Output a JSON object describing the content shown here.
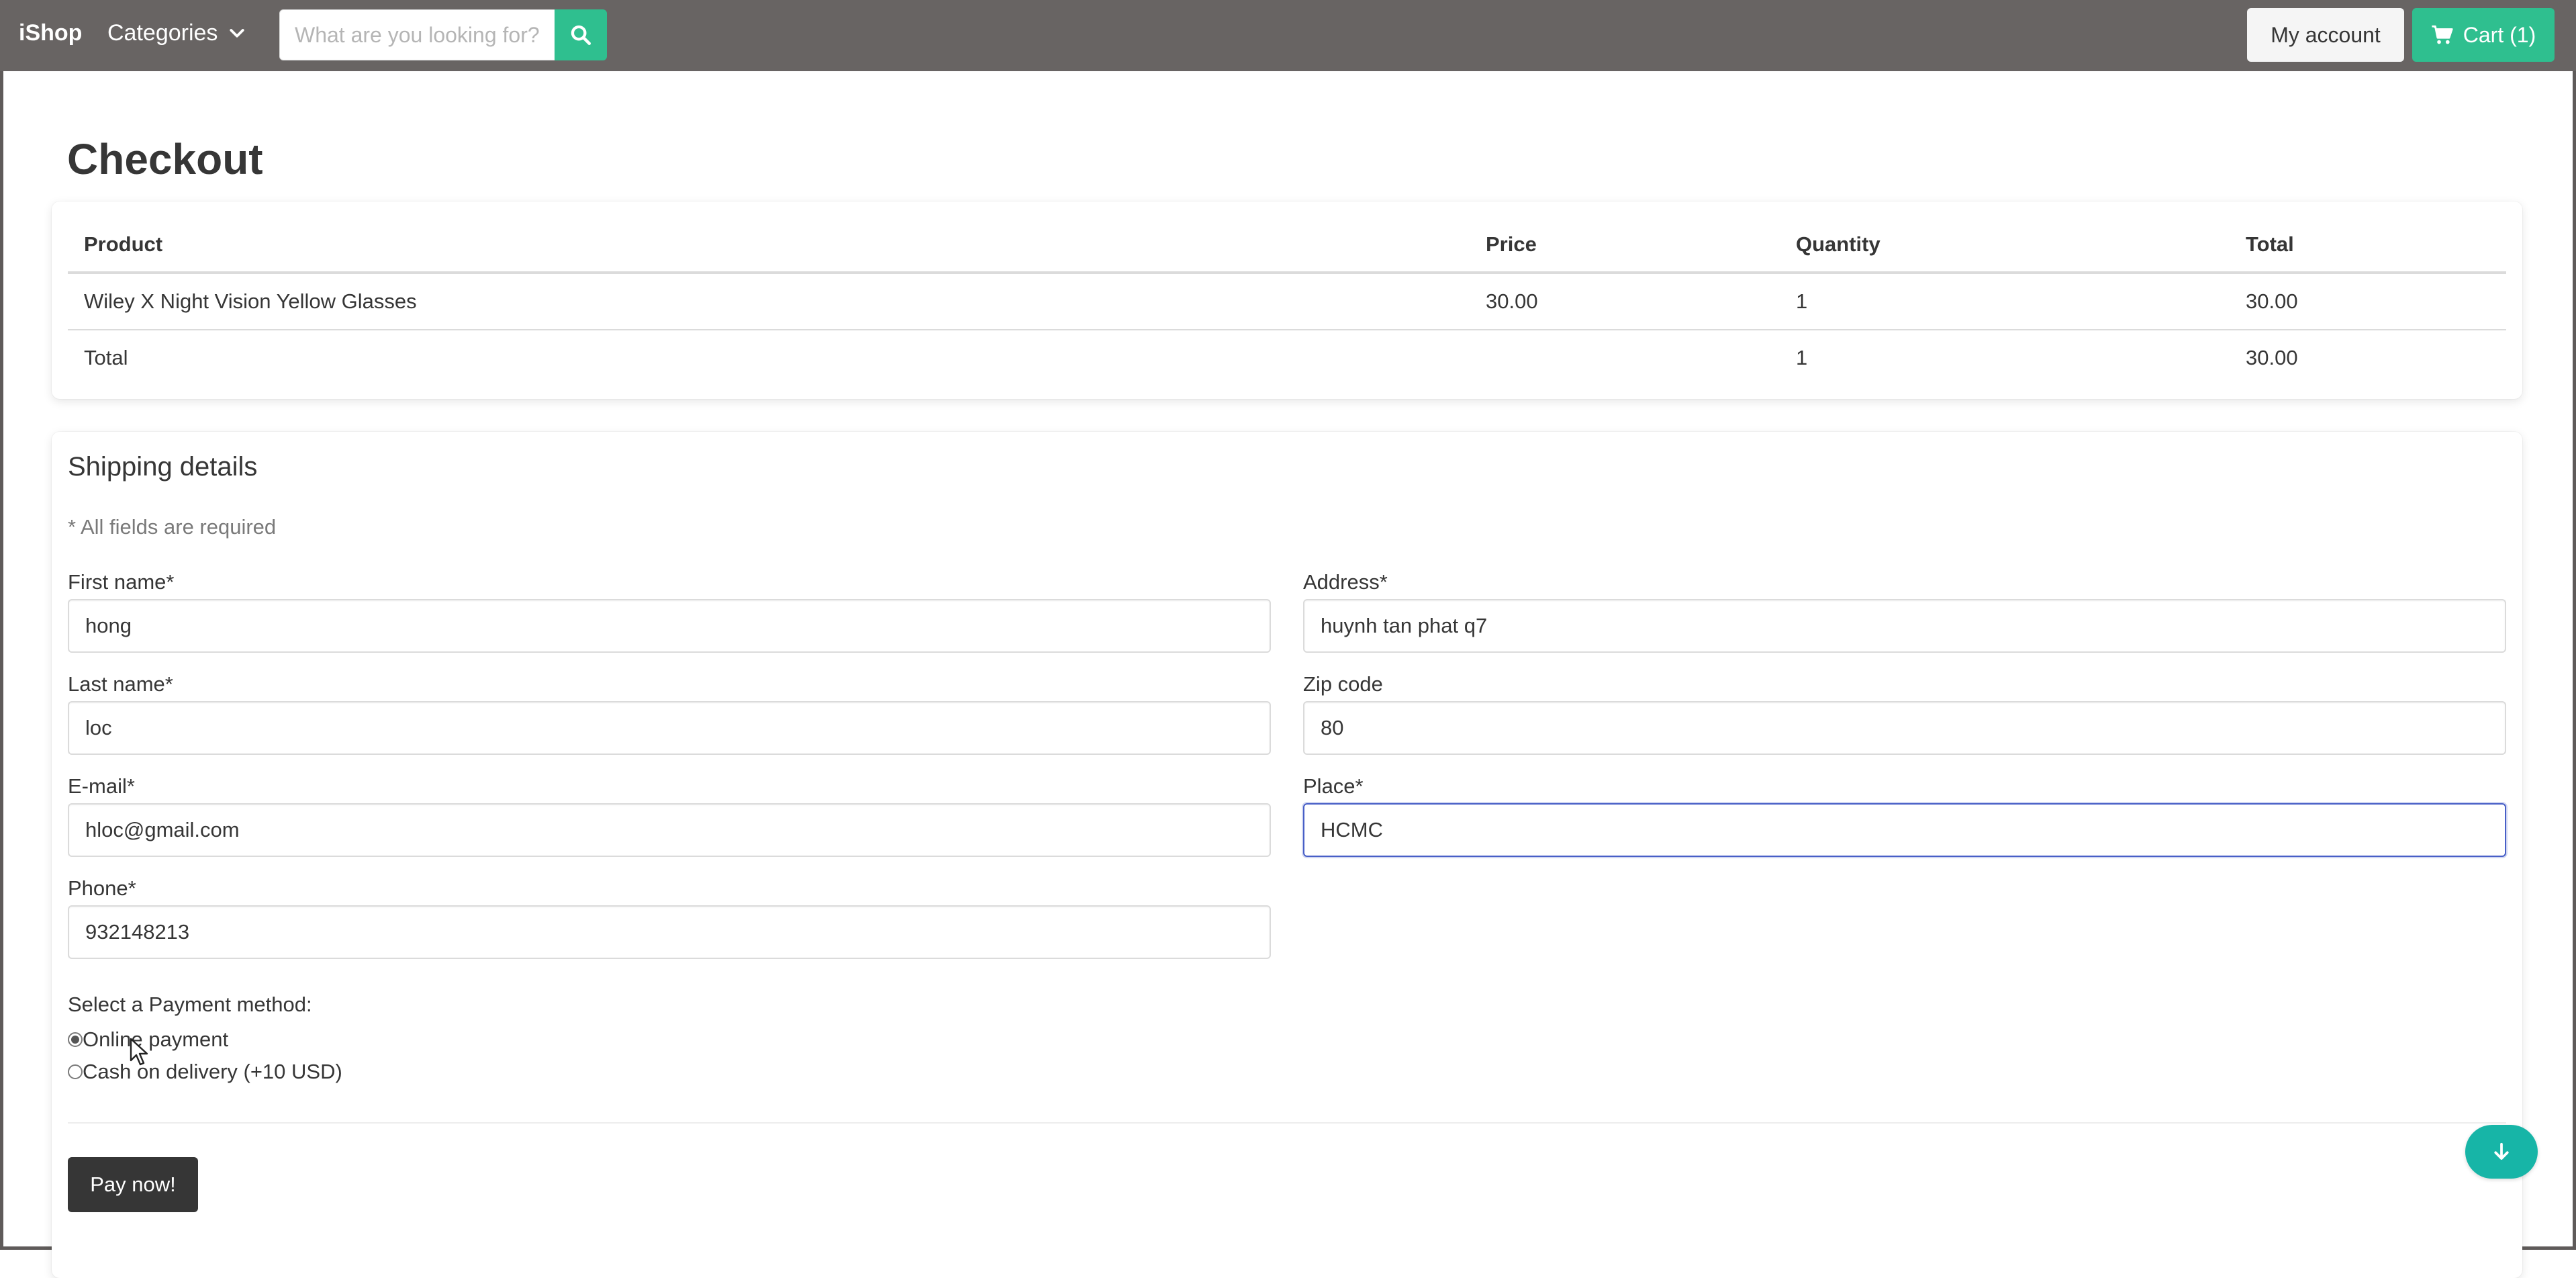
{
  "navbar": {
    "brand": "iShop",
    "categories_label": "Categories",
    "search_placeholder": "What are you looking for?",
    "account_label": "My account",
    "cart_label": "Cart (1)",
    "accent_color": "#2fbf8f"
  },
  "page": {
    "title": "Checkout"
  },
  "order": {
    "headers": [
      "Product",
      "Price",
      "Quantity",
      "Total"
    ],
    "rows": [
      {
        "product": "Wiley X Night Vision Yellow Glasses",
        "price": "30.00",
        "quantity": "1",
        "total": "30.00"
      }
    ],
    "total_row": {
      "label": "Total",
      "quantity": "1",
      "total": "30.00"
    }
  },
  "shipping": {
    "title": "Shipping details",
    "required_note": "* All fields are required",
    "fields": {
      "first_name": {
        "label": "First name*",
        "value": "hong"
      },
      "last_name": {
        "label": "Last name*",
        "value": "loc"
      },
      "email": {
        "label": "E-mail*",
        "value": "hloc@gmail.com"
      },
      "phone": {
        "label": "Phone*",
        "value": "932148213"
      },
      "address": {
        "label": "Address*",
        "value": "huynh tan phat q7"
      },
      "zip": {
        "label": "Zip code",
        "value": "80"
      },
      "place": {
        "label": "Place*",
        "value": "HCMC"
      }
    },
    "payment": {
      "label": "Select a Payment method:",
      "options": [
        "Online payment",
        "Cash on delivery (+10 USD)"
      ],
      "selected": "Online payment"
    },
    "pay_button": "Pay now!"
  },
  "icons": {
    "search": "search-icon",
    "chevron": "chevron-down-icon",
    "cart": "cart-icon",
    "scroll": "arrow-down-icon"
  }
}
